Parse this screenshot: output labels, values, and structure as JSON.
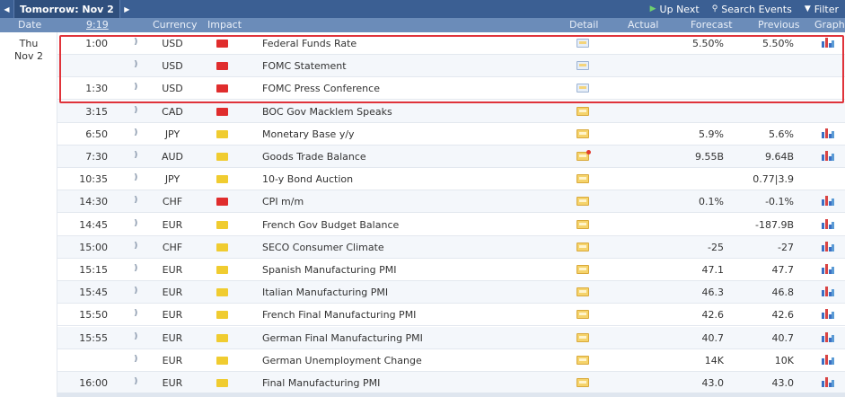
{
  "topbar": {
    "prev_icon": "arrow-left-icon",
    "date_tab": "Tomorrow: Nov 2",
    "next_icon": "arrow-right-icon",
    "up_next": "Up Next",
    "search_events": "Search Events",
    "filter": "Filter"
  },
  "columns": {
    "date": "Date",
    "time": "9:19",
    "currency": "Currency",
    "impact": "Impact",
    "detail": "Detail",
    "actual": "Actual",
    "forecast": "Forecast",
    "previous": "Previous",
    "graph": "Graph"
  },
  "day": {
    "weekday": "Thu",
    "date": "Nov 2"
  },
  "colors": {
    "header_bg": "#3b5f93",
    "subheader_bg": "#6b8cb9",
    "impact_high": "#e02d2d",
    "impact_low": "#f0cc30",
    "highlight_border": "#e0333a"
  },
  "events": [
    {
      "time": "1:00",
      "currency": "USD",
      "impact": "high",
      "event": "Federal Funds Rate",
      "detail_icon": "blue",
      "actual": "",
      "forecast": "5.50%",
      "previous": "5.50%",
      "graph": true
    },
    {
      "time": "",
      "currency": "USD",
      "impact": "high",
      "event": "FOMC Statement",
      "detail_icon": "blue",
      "actual": "",
      "forecast": "",
      "previous": "",
      "graph": false
    },
    {
      "time": "1:30",
      "currency": "USD",
      "impact": "high",
      "event": "FOMC Press Conference",
      "detail_icon": "blue",
      "actual": "",
      "forecast": "",
      "previous": "",
      "graph": false
    },
    {
      "time": "3:15",
      "currency": "CAD",
      "impact": "high",
      "event": "BOC Gov Macklem Speaks",
      "detail_icon": "yellow",
      "actual": "",
      "forecast": "",
      "previous": "",
      "graph": false
    },
    {
      "time": "6:50",
      "currency": "JPY",
      "impact": "low",
      "event": "Monetary Base y/y",
      "detail_icon": "yellow",
      "actual": "",
      "forecast": "5.9%",
      "previous": "5.6%",
      "graph": true
    },
    {
      "time": "7:30",
      "currency": "AUD",
      "impact": "low",
      "event": "Goods Trade Balance",
      "detail_icon": "red",
      "actual": "",
      "forecast": "9.55B",
      "previous": "9.64B",
      "graph": true
    },
    {
      "time": "10:35",
      "currency": "JPY",
      "impact": "low",
      "event": "10-y Bond Auction",
      "detail_icon": "yellow",
      "actual": "",
      "forecast": "",
      "previous": "0.77|3.9",
      "graph": false
    },
    {
      "time": "14:30",
      "currency": "CHF",
      "impact": "high",
      "event": "CPI m/m",
      "detail_icon": "yellow",
      "actual": "",
      "forecast": "0.1%",
      "previous": "-0.1%",
      "graph": true
    },
    {
      "time": "14:45",
      "currency": "EUR",
      "impact": "low",
      "event": "French Gov Budget Balance",
      "detail_icon": "yellow",
      "actual": "",
      "forecast": "",
      "previous": "-187.9B",
      "graph": true
    },
    {
      "time": "15:00",
      "currency": "CHF",
      "impact": "low",
      "event": "SECO Consumer Climate",
      "detail_icon": "yellow",
      "actual": "",
      "forecast": "-25",
      "previous": "-27",
      "graph": true
    },
    {
      "time": "15:15",
      "currency": "EUR",
      "impact": "low",
      "event": "Spanish Manufacturing PMI",
      "detail_icon": "yellow",
      "actual": "",
      "forecast": "47.1",
      "previous": "47.7",
      "graph": true
    },
    {
      "time": "15:45",
      "currency": "EUR",
      "impact": "low",
      "event": "Italian Manufacturing PMI",
      "detail_icon": "yellow",
      "actual": "",
      "forecast": "46.3",
      "previous": "46.8",
      "graph": true
    },
    {
      "time": "15:50",
      "currency": "EUR",
      "impact": "low",
      "event": "French Final Manufacturing PMI",
      "detail_icon": "yellow",
      "actual": "",
      "forecast": "42.6",
      "previous": "42.6",
      "graph": true
    },
    {
      "time": "15:55",
      "currency": "EUR",
      "impact": "low",
      "event": "German Final Manufacturing PMI",
      "detail_icon": "yellow",
      "actual": "",
      "forecast": "40.7",
      "previous": "40.7",
      "graph": true
    },
    {
      "time": "",
      "currency": "EUR",
      "impact": "low",
      "event": "German Unemployment Change",
      "detail_icon": "yellow",
      "actual": "",
      "forecast": "14K",
      "previous": "10K",
      "graph": true
    },
    {
      "time": "16:00",
      "currency": "EUR",
      "impact": "low",
      "event": "Final Manufacturing PMI",
      "detail_icon": "yellow",
      "actual": "",
      "forecast": "43.0",
      "previous": "43.0",
      "graph": true
    }
  ]
}
